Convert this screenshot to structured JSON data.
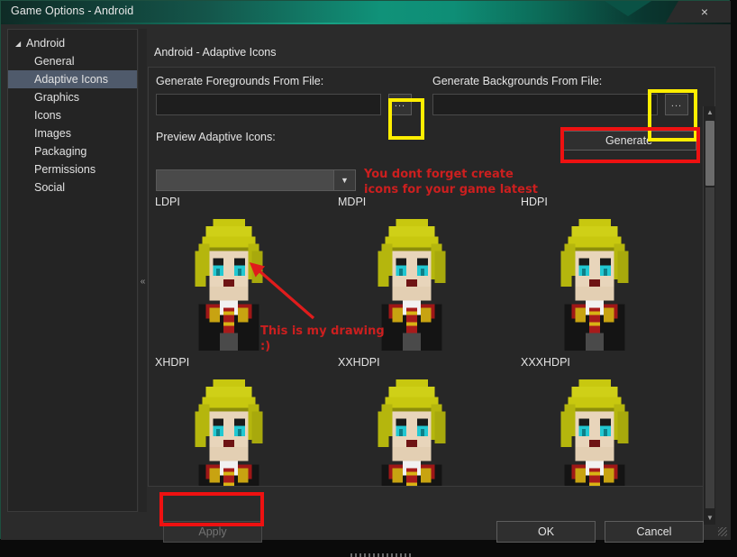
{
  "window": {
    "title": "Game Options - Android",
    "close_label": "×"
  },
  "sidebar": {
    "root": {
      "label": "Android",
      "caret": "◢"
    },
    "items": [
      {
        "label": "General",
        "selected": false
      },
      {
        "label": "Adaptive Icons",
        "selected": true
      },
      {
        "label": "Graphics",
        "selected": false
      },
      {
        "label": "Icons",
        "selected": false
      },
      {
        "label": "Images",
        "selected": false
      },
      {
        "label": "Packaging",
        "selected": false
      },
      {
        "label": "Permissions",
        "selected": false
      },
      {
        "label": "Social",
        "selected": false
      }
    ]
  },
  "splitter": {
    "collapse_glyph": "«"
  },
  "content": {
    "heading": "Android - Adaptive Icons",
    "foreground_label": "Generate Foregrounds From File:",
    "foreground_value": "",
    "background_label": "Generate Backgrounds From File:",
    "background_value": "",
    "browse_label": "...",
    "preview_label": "Preview Adaptive Icons:",
    "preview_combo_value": "",
    "generate_label": "Generate",
    "dpi_cells": [
      {
        "label": "LDPI"
      },
      {
        "label": "MDPI"
      },
      {
        "label": "HDPI"
      },
      {
        "label": "XHDPI"
      },
      {
        "label": "XXHDPI"
      },
      {
        "label": "XXXHDPI"
      }
    ]
  },
  "scrollbar": {
    "up_glyph": "▲",
    "down_glyph": "▼"
  },
  "footer": {
    "apply_label": "Apply",
    "ok_label": "OK",
    "cancel_label": "Cancel"
  },
  "annotations": {
    "note_top_line1": "You dont forget create",
    "note_top_line2": "icons for your game latest",
    "note_drawing_line1": "This is my drawing",
    "note_drawing_line2": ":)",
    "highlight_color_yellow": "#ffee00",
    "highlight_color_red": "#ee1111",
    "note_text_color": "#cc1f1f"
  },
  "theme": {
    "titlebar_accent": "#109279",
    "window_background": "#2b2b2b",
    "panel_background": "#272727",
    "selection_color": "#4f5a6b",
    "text_color": "#e4e4e4",
    "icon_hair": "#c8c80f",
    "icon_eyes": "#21c8d2",
    "icon_skin": "#e8d5bb",
    "icon_robe": "#141414",
    "icon_tie": "#a81b1b"
  }
}
